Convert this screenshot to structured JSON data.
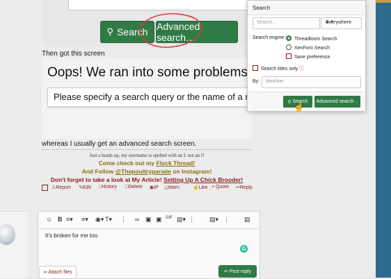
{
  "first_screenshot": {
    "search_button": "Search",
    "advanced_button": "Advanced search…"
  },
  "caption": "Then got this screen",
  "error_screen": {
    "title": "Oops! We ran into some problems.",
    "message": "Please specify a search query or the name of a member"
  },
  "post_text": "whereas I usually get an advanced search screen.",
  "signature": {
    "line1": "Just a heads up, my username is spelled with an L not an I!",
    "line2_prefix": "Come check out my ",
    "line2_link": "Flock Thread!",
    "line3_prefix": "And Follow ",
    "line3_link": "@Thepoultryparade",
    "line3_suffix": " on Instagram!",
    "line4_prefix": "Don't forget to take a look at My Article! ",
    "line4_link": "Setting Up A Chick Brooder!"
  },
  "actions": {
    "report": "Report",
    "edit": "Edit",
    "history": "History",
    "delete": "Delete",
    "ip": "IP",
    "warn": "Warn",
    "like": "Like",
    "quote": "+ Quote",
    "reply": "Reply"
  },
  "editor": {
    "text": "It's broken for me too.",
    "attach_files": "Attach files",
    "post_reply": "Post reply"
  },
  "search_panel": {
    "title": "Search",
    "input_placeholder": "Search…",
    "scope_selected": "Everywhere",
    "engine_label": "Search engine:",
    "engine_options": [
      "Threadloom Search",
      "XenForo Search"
    ],
    "save_preference": "Save preference",
    "titles_only": "Search titles only",
    "by_label": "By:",
    "member_placeholder": "Member",
    "search_button": "Search",
    "advanced_button": "Advanced search…"
  },
  "colors": {
    "accent_green": "#2f7a45",
    "link_red": "#8a1a1a",
    "annotation_red": "#e03a3a",
    "side_blue": "#2d6b8e"
  }
}
